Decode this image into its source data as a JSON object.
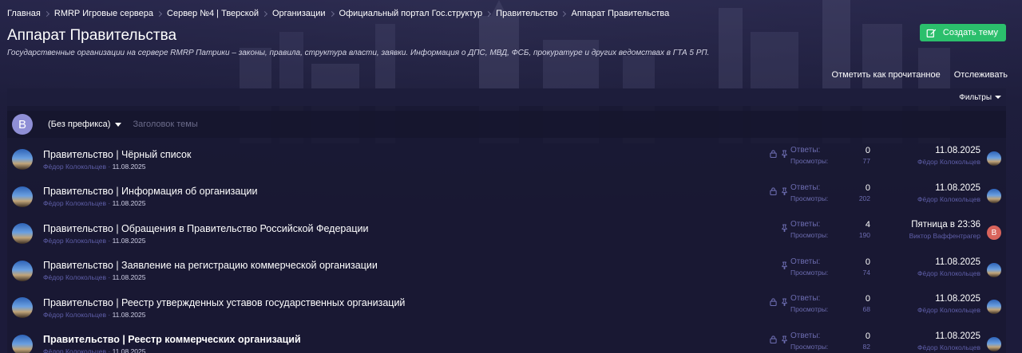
{
  "breadcrumb": [
    "Главная",
    "RMRP Игровые сервера",
    "Сервер №4 | Тверской",
    "Организации",
    "Официальный портал Гос.структур",
    "Правительство",
    "Аппарат Правительства"
  ],
  "page": {
    "title": "Аппарат Правительства",
    "description": "Государственные организации на сервере RMRP Патрики – законы, правила, структура власти, заявки. Информация о ДПС, МВД, ФСБ, прокуратуре и других ведомствах в ГТА 5 РП.",
    "create_label": "Создать тему",
    "mark_read_label": "Отметить как прочитанное",
    "watch_label": "Отслеживать",
    "filters_label": "Фильтры"
  },
  "new_thread": {
    "avatar_letter": "B",
    "prefix_label": "(Без префикса)",
    "title_placeholder": "Заголовок темы"
  },
  "labels": {
    "replies": "Ответы:",
    "views": "Просмотры:"
  },
  "threads": [
    {
      "title": "Правительство | Чёрный список",
      "author": "Фёдор Колокольцев",
      "date": "11.08.2025",
      "replies": "0",
      "views": "77",
      "last_date": "11.08.2025",
      "last_user": "Фёдор Колокольцев",
      "locked": true,
      "pinned": true,
      "bold": false
    },
    {
      "title": "Правительство | Информация об организации",
      "author": "Фёдор Колокольцев",
      "date": "11.08.2025",
      "replies": "0",
      "views": "202",
      "last_date": "11.08.2025",
      "last_user": "Фёдор Колокольцев",
      "locked": true,
      "pinned": true,
      "bold": false
    },
    {
      "title": "Правительство | Обращения в Правительство Российской Федерации",
      "author": "Фёдор Колокольцев",
      "date": "11.08.2025",
      "replies": "4",
      "views": "190",
      "last_date": "Пятница в 23:36",
      "last_user": "Виктор Ваффентрагер",
      "last_avatar_letter": "B",
      "locked": false,
      "pinned": true,
      "bold": false
    },
    {
      "title": "Правительство | Заявление на регистрацию коммерческой организации",
      "author": "Фёдор Колокольцев",
      "date": "11.08.2025",
      "replies": "0",
      "views": "74",
      "last_date": "11.08.2025",
      "last_user": "Фёдор Колокольцев",
      "locked": false,
      "pinned": true,
      "bold": false
    },
    {
      "title": "Правительство | Реестр утвержденных уставов государственных организаций",
      "author": "Фёдор Колокольцев",
      "date": "11.08.2025",
      "replies": "0",
      "views": "68",
      "last_date": "11.08.2025",
      "last_user": "Фёдор Колокольцев",
      "locked": true,
      "pinned": true,
      "bold": false
    },
    {
      "title": "Правительство | Реестр коммерческих организаций",
      "author": "Фёдор Колокольцев",
      "date": "11.08.2025",
      "replies": "0",
      "views": "82",
      "last_date": "11.08.2025",
      "last_user": "Фёдор Колокольцев",
      "locked": true,
      "pinned": true,
      "bold": true
    }
  ],
  "colors": {
    "accent_green": "#2bbf6c",
    "background": "#1b1b38",
    "meta_link": "#5e5ea8",
    "avatar_red": "#d9645c",
    "avatar_purple": "#8f8fd6"
  }
}
